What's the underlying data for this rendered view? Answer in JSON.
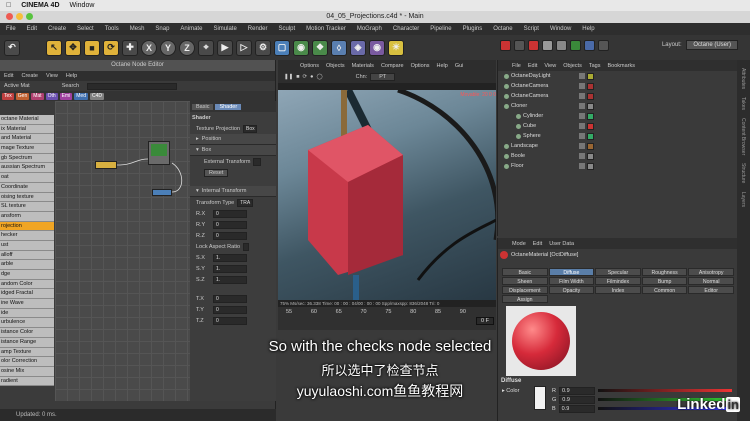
{
  "mac_menu": {
    "app": "CINEMA 4D",
    "items": [
      "Window"
    ]
  },
  "title": "04_05_Projections.c4d * - Main",
  "main_menu": [
    "File",
    "Edit",
    "Create",
    "Select",
    "Tools",
    "Mesh",
    "Snap",
    "Animate",
    "Simulate",
    "Render",
    "Sculpt",
    "Motion Tracker",
    "MoGraph",
    "Character",
    "Pipeline",
    "Plugins",
    "Octane",
    "Script",
    "Window",
    "Help"
  ],
  "toolbar": {
    "axis_buttons": [
      "X",
      "Y",
      "Z"
    ],
    "layout_label": "Layout:",
    "layout_value": "Octane (User)"
  },
  "node_editor": {
    "title": "Octane Node Editor",
    "menu": [
      "Edit",
      "Create",
      "View",
      "Help"
    ],
    "active_mat": "Active Mat",
    "search_label": "Search",
    "filter_chips": [
      {
        "label": "Tex",
        "color": "#c04040"
      },
      {
        "label": "Gen",
        "color": "#c06030"
      },
      {
        "label": "Mat",
        "color": "#b04070"
      },
      {
        "label": "Oth",
        "color": "#6a4fb0"
      },
      {
        "label": "Emi",
        "color": "#a040a0"
      },
      {
        "label": "Med",
        "color": "#4070b0"
      },
      {
        "label": "C4D",
        "color": "#808080"
      }
    ],
    "node_list": [
      "octane Material",
      "ix Material",
      "and Material",
      "mage Texture",
      "gb Spectrum",
      "aussian Spectrum",
      "oat",
      "Coordinate",
      "oising texture",
      "SL texture",
      "ansform",
      "rojection",
      "hecker",
      "ust",
      "alloff",
      "arble",
      "dge",
      "andom Color",
      "idged Fractal",
      "ine Wave",
      "ide",
      "urbulence",
      "istance Color",
      "istance Range",
      "amp Texture",
      "olor Correction",
      "osine Mix",
      "radient"
    ],
    "selected_index": 11,
    "attr_tabs": [
      "Basic",
      "Shader"
    ],
    "attr_title": "Shader",
    "texture_projection_label": "Texture Projection",
    "texture_projection_value": "Box",
    "groups": {
      "position": "Position",
      "box": "Box",
      "internal": "Internal Transform"
    },
    "external_transform": "External Transform",
    "reset": "Reset",
    "transform_type": "Transform Type",
    "transform_type_value": "TRA",
    "rows_r": [
      {
        "label": "R.X",
        "value": "0"
      },
      {
        "label": "R.Y",
        "value": "0"
      },
      {
        "label": "R.Z",
        "value": "0"
      }
    ],
    "lock_aspect": "Lock Aspect Ratio",
    "rows_s": [
      {
        "label": "S.X",
        "value": "1."
      },
      {
        "label": "S.Y",
        "value": "1."
      },
      {
        "label": "S.Z",
        "value": "1."
      }
    ],
    "rows_t": [
      {
        "label": "T.X",
        "value": "0"
      },
      {
        "label": "T.Y",
        "value": "0"
      },
      {
        "label": "T.Z",
        "value": "0"
      }
    ],
    "status": "Updated: 0 ms."
  },
  "viewport": {
    "menu": [
      "Options",
      "Objects",
      "Materials",
      "Compare",
      "Options",
      "Help",
      "Gui"
    ],
    "channel_label": "Chn:",
    "channel_value": "PT",
    "info_text": "Movable: 20 0 0",
    "stats": "75%  Ms/sec: 36.338  Time: 00 : 00 : 04/00 : 00 : 00  Spp/maxspp: 836/2048  Tri: 0",
    "ruler": [
      "55",
      "60",
      "65",
      "70",
      "75",
      "80",
      "85",
      "90"
    ],
    "frame": "0 F"
  },
  "object_manager": {
    "menu": [
      "File",
      "Edit",
      "View",
      "Objects",
      "Tags",
      "Bookmarks"
    ],
    "objects": [
      {
        "name": "OctaneDayLight",
        "indent": 0
      },
      {
        "name": "OctaneCamera",
        "indent": 0
      },
      {
        "name": "OctaneCamera",
        "indent": 0
      },
      {
        "name": "Cloner",
        "indent": 0
      },
      {
        "name": "Cylinder",
        "indent": 1
      },
      {
        "name": "Cube",
        "indent": 1
      },
      {
        "name": "Sphere",
        "indent": 1
      },
      {
        "name": "Landscape",
        "indent": 0
      },
      {
        "name": "Boole",
        "indent": 0
      },
      {
        "name": "Floor",
        "indent": 0
      }
    ]
  },
  "material_manager": {
    "menu": [
      "Mode",
      "Edit",
      "User Data"
    ],
    "title": "OctaneMaterial [OctDiffuse]",
    "tabs": [
      "Basic",
      "Diffuse",
      "Specular",
      "Roughness",
      "Anisotropy",
      "Sheen",
      "Film Width",
      "Filmindex",
      "Bump",
      "Normal",
      "Displacement",
      "Opacity",
      "Index",
      "Common",
      "Editor",
      "Assign"
    ],
    "active_tab": "Diffuse",
    "diffuse_label": "Diffuse",
    "color_label": "Color",
    "rgb": [
      {
        "label": "R",
        "value": "0.9"
      },
      {
        "label": "G",
        "value": "0.9"
      },
      {
        "label": "B",
        "value": "0.9"
      }
    ]
  },
  "side_tabs": [
    "Attributes",
    "Takes",
    "Content Browser",
    "Structure",
    "Layers"
  ],
  "subtitles": {
    "en": "So with the checks node selected",
    "cn": "所以选中了检查节点",
    "watermark": "yuyulaoshi.com鱼鱼教程网"
  },
  "linkedin": {
    "text": "Linked",
    "badge": "in"
  }
}
